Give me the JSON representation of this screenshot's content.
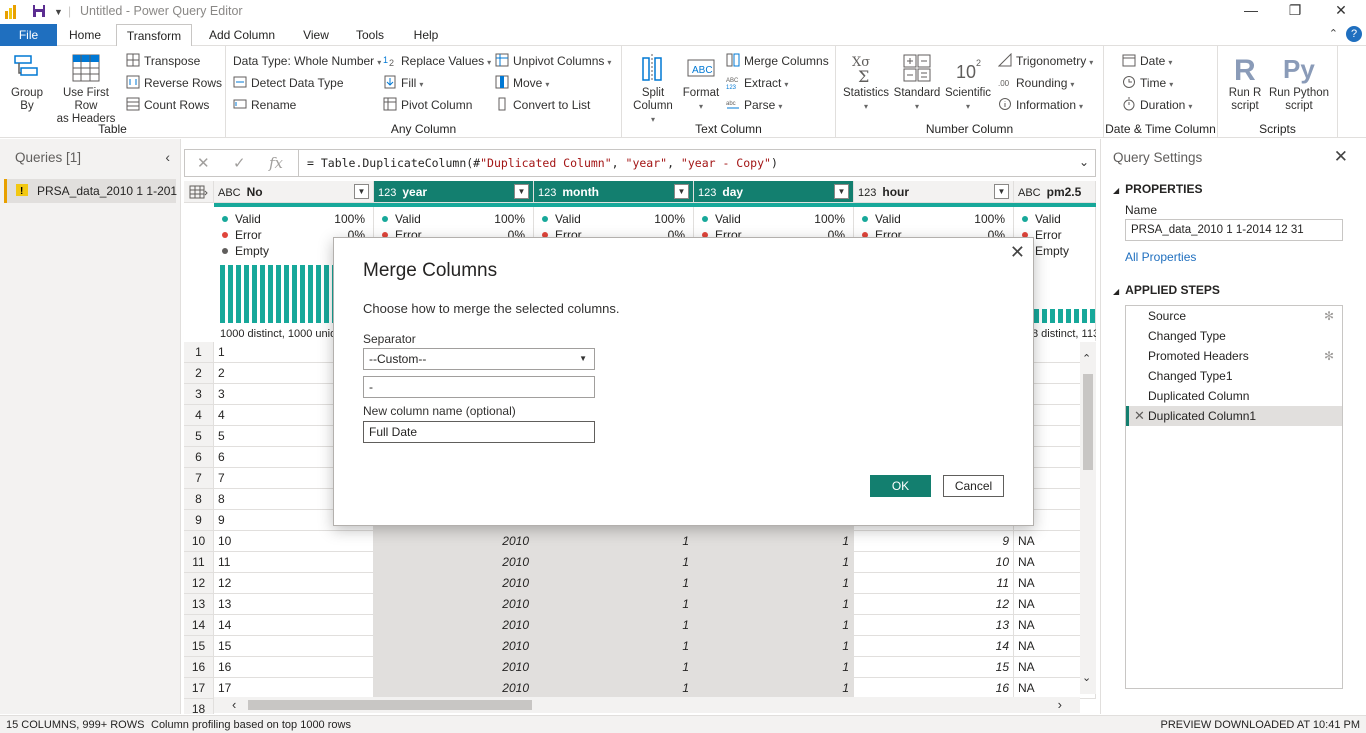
{
  "window": {
    "title": "Untitled - Power Query Editor",
    "minimize_glyph": "—",
    "restore_glyph": "❐",
    "close_glyph": "✕"
  },
  "tabs": {
    "file": "File",
    "home": "Home",
    "transform": "Transform",
    "add_column": "Add Column",
    "view": "View",
    "tools": "Tools",
    "help": "Help"
  },
  "ribbon": {
    "table": {
      "label": "Table",
      "group_by": "Group\nBy",
      "use_first_row": "Use First Row\nas Headers",
      "transpose": "Transpose",
      "reverse_rows": "Reverse Rows",
      "count_rows": "Count Rows"
    },
    "any_column": {
      "label": "Any Column",
      "data_type": "Data Type: Whole Number",
      "detect_data_type": "Detect Data Type",
      "rename": "Rename",
      "replace_values": "Replace Values",
      "fill": "Fill",
      "pivot_column": "Pivot Column",
      "unpivot_columns": "Unpivot Columns",
      "move": "Move",
      "convert_to_list": "Convert to List"
    },
    "text_column": {
      "label": "Text Column",
      "split_column": "Split\nColumn",
      "format": "Format",
      "merge_columns": "Merge Columns",
      "extract": "Extract",
      "parse": "Parse"
    },
    "number_column": {
      "label": "Number Column",
      "statistics": "Statistics",
      "standard": "Standard",
      "scientific": "Scientific",
      "trigonometry": "Trigonometry",
      "rounding": "Rounding",
      "information": "Information"
    },
    "datetime_column": {
      "label": "Date & Time Column",
      "date": "Date",
      "time": "Time",
      "duration": "Duration"
    },
    "scripts": {
      "label": "Scripts",
      "run_r": "Run R\nscript",
      "run_python": "Run Python\nscript"
    }
  },
  "queries": {
    "header": "Queries [1]",
    "items": [
      {
        "label": "PRSA_data_2010 1 1-201..."
      }
    ]
  },
  "formula_bar": {
    "prefix": "= Table.DuplicateColumn(#",
    "arg1": "\"Duplicated Column\"",
    "comma1": ", ",
    "arg2": "\"year\"",
    "comma2": ", ",
    "arg3": "\"year - Copy\"",
    "suffix": ")"
  },
  "grid": {
    "columns": [
      {
        "name": "No",
        "type": "ABC",
        "selected": false,
        "valid": "100%",
        "error": "0%",
        "empty": "",
        "distinct": "1000 distinct, 1000 uniq"
      },
      {
        "name": "year",
        "type": "123",
        "selected": true,
        "valid": "100%",
        "error": "0%",
        "empty": "",
        "distinct": ""
      },
      {
        "name": "month",
        "type": "123",
        "selected": true,
        "valid": "100%",
        "error": "0%",
        "empty": "",
        "distinct": ""
      },
      {
        "name": "day",
        "type": "123",
        "selected": true,
        "valid": "100%",
        "error": "0%",
        "empty": "",
        "distinct": ""
      },
      {
        "name": "hour",
        "type": "123",
        "selected": false,
        "valid": "100%",
        "error": "0%",
        "empty": "",
        "distinct": ""
      },
      {
        "name": "pm2.5",
        "type": "ABC",
        "selected": false,
        "valid": "",
        "error": "",
        "empty": "",
        "distinct": "8 distinct, 113"
      }
    ],
    "labels": {
      "valid": "Valid",
      "error": "Error",
      "empty": "Empty"
    },
    "row_numbers": [
      "1",
      "2",
      "3",
      "4",
      "5",
      "6",
      "7",
      "8",
      "9",
      "10",
      "11",
      "12",
      "13",
      "14",
      "15",
      "16",
      "17",
      "18"
    ],
    "rows": [
      [
        "1",
        "",
        "",
        "",
        "",
        ""
      ],
      [
        "2",
        "",
        "",
        "",
        "",
        ""
      ],
      [
        "3",
        "",
        "",
        "",
        "",
        ""
      ],
      [
        "4",
        "",
        "",
        "",
        "",
        ""
      ],
      [
        "5",
        "",
        "",
        "",
        "",
        ""
      ],
      [
        "6",
        "",
        "",
        "",
        "",
        ""
      ],
      [
        "7",
        "",
        "",
        "",
        "",
        ""
      ],
      [
        "8",
        "",
        "",
        "",
        "",
        ""
      ],
      [
        "9",
        "",
        "",
        "",
        "",
        ""
      ],
      [
        "10",
        "2010",
        "1",
        "1",
        "9",
        "NA"
      ],
      [
        "11",
        "2010",
        "1",
        "1",
        "10",
        "NA"
      ],
      [
        "12",
        "2010",
        "1",
        "1",
        "11",
        "NA"
      ],
      [
        "13",
        "2010",
        "1",
        "1",
        "12",
        "NA"
      ],
      [
        "14",
        "2010",
        "1",
        "1",
        "13",
        "NA"
      ],
      [
        "15",
        "2010",
        "1",
        "1",
        "14",
        "NA"
      ],
      [
        "16",
        "2010",
        "1",
        "1",
        "15",
        "NA"
      ],
      [
        "17",
        "2010",
        "1",
        "1",
        "16",
        "NA"
      ]
    ]
  },
  "settings": {
    "header": "Query Settings",
    "properties": "PROPERTIES",
    "name_label": "Name",
    "name_value": "PRSA_data_2010 1 1-2014 12 31",
    "all_properties": "All Properties",
    "applied_steps": "APPLIED STEPS",
    "steps": [
      {
        "label": "Source",
        "gear": true,
        "selected": false
      },
      {
        "label": "Changed Type",
        "gear": false,
        "selected": false
      },
      {
        "label": "Promoted Headers",
        "gear": true,
        "selected": false
      },
      {
        "label": "Changed Type1",
        "gear": false,
        "selected": false
      },
      {
        "label": "Duplicated Column",
        "gear": false,
        "selected": false
      },
      {
        "label": "Duplicated Column1",
        "gear": false,
        "selected": true
      }
    ]
  },
  "status": {
    "left1": "15 COLUMNS, 999+ ROWS",
    "left2": "Column profiling based on top 1000 rows",
    "right": "PREVIEW DOWNLOADED AT 10:41 PM"
  },
  "dialog": {
    "title": "Merge Columns",
    "description": "Choose how to merge the selected columns.",
    "separator_label": "Separator",
    "separator_value": "--Custom--",
    "custom_value": "-",
    "newcol_label": "New column name (optional)",
    "newcol_value": "Full Date",
    "ok": "OK",
    "cancel": "Cancel"
  },
  "colors": {
    "accent_teal": "#137f6f",
    "file_tab_blue": "#1f6fbf",
    "valid_dot": "#17a89a",
    "error_dot": "#e0453b",
    "empty_dot": "#605e5c"
  }
}
